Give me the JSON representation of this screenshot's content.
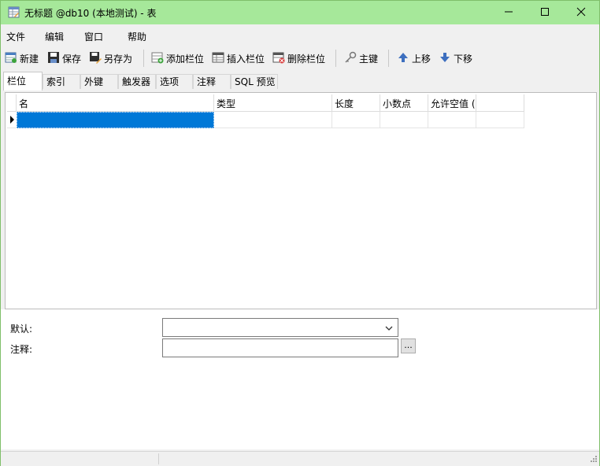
{
  "window": {
    "title": "无标题 @db10 (本地测试) - 表",
    "minimize_glyph": "—",
    "maximize_glyph": "☐",
    "close_glyph": "✕"
  },
  "menu": [
    "文件",
    "编辑",
    "窗口",
    "帮助"
  ],
  "toolbar": {
    "new": "新建",
    "save": "保存",
    "save_as": "另存为",
    "add_column": "添加栏位",
    "insert_column": "插入栏位",
    "delete_column": "删除栏位",
    "primary_key": "主键",
    "move_up": "上移",
    "move_down": "下移"
  },
  "tabs": [
    "栏位",
    "索引",
    "外键",
    "触发器",
    "选项",
    "注释",
    "SQL 预览"
  ],
  "grid": {
    "columns": [
      "名",
      "类型",
      "长度",
      "小数点",
      "允许空值 (",
      ""
    ],
    "rows": [
      [
        "",
        "",
        "",
        "",
        "",
        ""
      ]
    ],
    "selected_cell_color": "#0078d7"
  },
  "properties": {
    "default_label": "默认:",
    "default_value": "",
    "comment_label": "注释:",
    "comment_value": "",
    "ellipsis_label": "..."
  },
  "colors": {
    "titlebar": "#a6e89a"
  }
}
